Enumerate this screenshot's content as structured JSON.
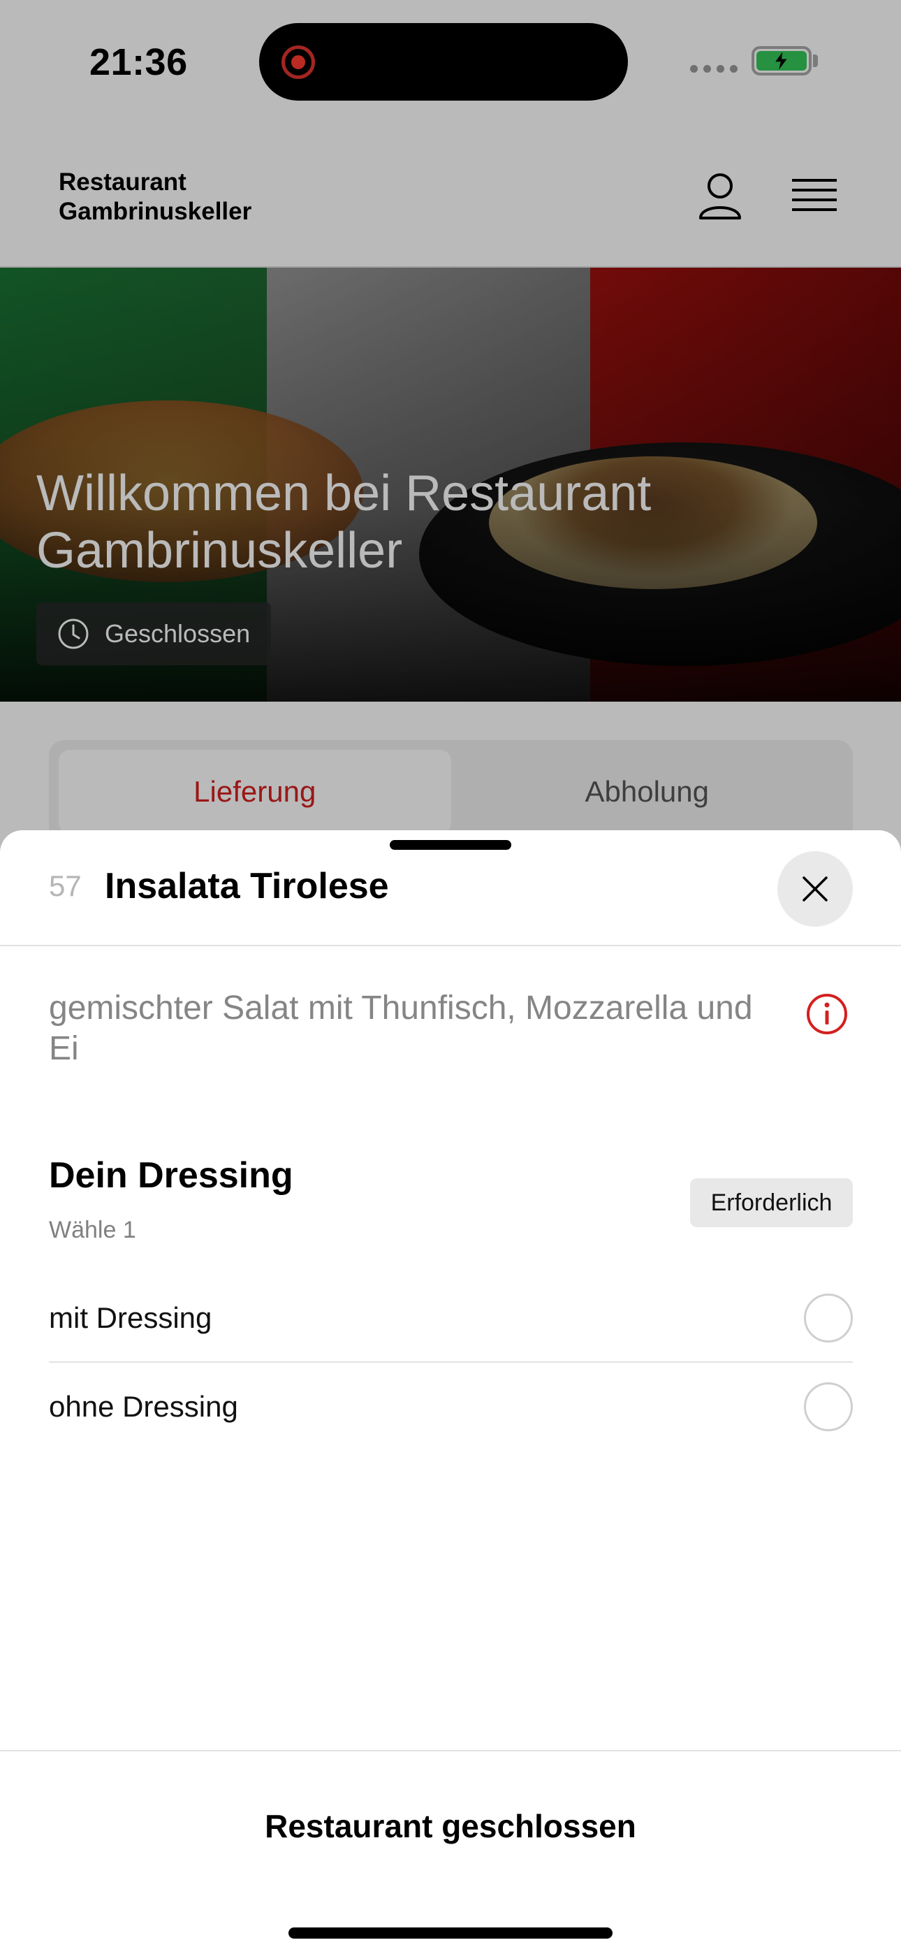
{
  "status_bar": {
    "time": "21:36",
    "icons": [
      "screen-record-icon",
      "signal-icon",
      "battery-charging-icon"
    ],
    "battery_color": "#34c759"
  },
  "header": {
    "brand": "Restaurant\nGambrinuskeller",
    "icons": [
      "user-icon",
      "menu-icon"
    ]
  },
  "hero": {
    "title": "Willkommen bei Restaurant Gambrinuskeller",
    "status_badge": "Geschlossen",
    "status_icon": "clock-icon"
  },
  "tabs": [
    {
      "label": "Lieferung",
      "active": true
    },
    {
      "label": "Abholung",
      "active": false
    }
  ],
  "sheet": {
    "item_number": "57",
    "item_title": "Insalata Tirolese",
    "description": "gemischter Salat mit Thunfisch, Mozzarella und Ei",
    "option_group": {
      "title": "Dein Dressing",
      "subtitle": "Wähle 1",
      "required_label": "Erforderlich",
      "options": [
        {
          "label": "mit Dressing",
          "selected": false
        },
        {
          "label": "ohne Dressing",
          "selected": false
        }
      ]
    },
    "footer_button": "Restaurant geschlossen"
  },
  "colors": {
    "accent_red": "#d32020",
    "muted_text": "#858585"
  }
}
